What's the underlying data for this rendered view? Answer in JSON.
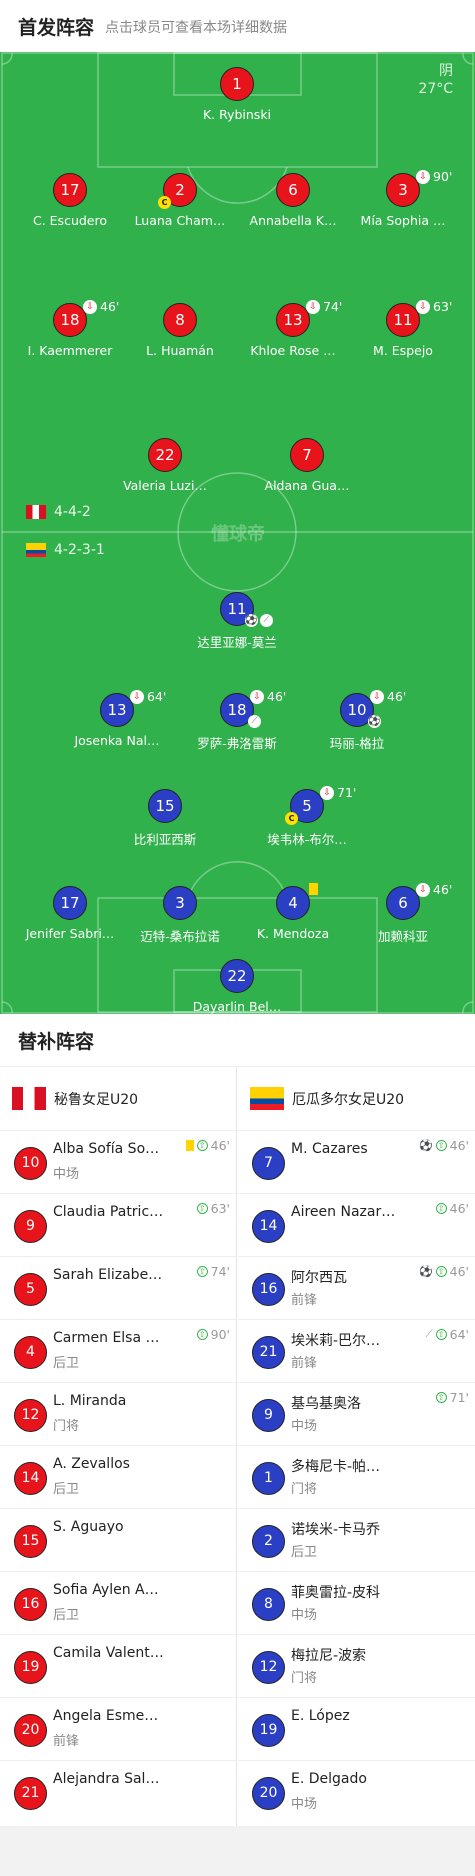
{
  "starting": {
    "title": "首发阵容",
    "subtitle": "点击球员可查看本场详细数据"
  },
  "weather": {
    "condition": "阴",
    "temp": "27°C"
  },
  "watermark": "懂球帝",
  "formations": {
    "home": "4-4-2",
    "away": "4-2-3-1"
  },
  "home_starters": [
    {
      "num": "1",
      "name": "K. Rybinski"
    },
    {
      "num": "17",
      "name": "C. Escudero"
    },
    {
      "num": "2",
      "name": "Luana Cham…",
      "captain": "C"
    },
    {
      "num": "6",
      "name": "Annabella K…"
    },
    {
      "num": "3",
      "name": "Mía Sophia …",
      "sub": "90'"
    },
    {
      "num": "18",
      "name": "I. Kaemmerer",
      "sub": "46'"
    },
    {
      "num": "8",
      "name": "L. Huamán"
    },
    {
      "num": "13",
      "name": "Khloe Rose …",
      "sub": "74'"
    },
    {
      "num": "11",
      "name": "M. Espejo",
      "sub": "63'"
    },
    {
      "num": "22",
      "name": "Valeria Luzi…"
    },
    {
      "num": "7",
      "name": "Aldana Gua…"
    }
  ],
  "away_starters": [
    {
      "num": "11",
      "name": "达里亚娜-莫兰",
      "goal": true,
      "assist": true
    },
    {
      "num": "13",
      "name": "Josenka Nal…",
      "sub": "64'"
    },
    {
      "num": "18",
      "name": "罗萨-弗洛雷斯",
      "sub": "46'",
      "assist": true
    },
    {
      "num": "10",
      "name": "玛丽-格拉",
      "sub": "46'",
      "goal": true
    },
    {
      "num": "15",
      "name": "比利亚西斯"
    },
    {
      "num": "5",
      "name": "埃韦林-布尔…",
      "sub": "71'",
      "captain": "C"
    },
    {
      "num": "17",
      "name": "Jenifer Sabri…"
    },
    {
      "num": "3",
      "name": "迈特-桑布拉诺"
    },
    {
      "num": "4",
      "name": "K. Mendoza",
      "yellow": true
    },
    {
      "num": "6",
      "name": "加赖科亚",
      "sub": "46'"
    },
    {
      "num": "22",
      "name": "Dayarlin Bel…"
    }
  ],
  "bench": {
    "title": "替补阵容",
    "home_team": "秘鲁女足U20",
    "away_team": "厄瓜多尔女足U20",
    "home": [
      {
        "num": "10",
        "name": "Alba Sofía So…",
        "pos": "中场",
        "yellow": true,
        "in": "46'"
      },
      {
        "num": "9",
        "name": "Claudia Patric…",
        "pos": "",
        "in": "63'"
      },
      {
        "num": "5",
        "name": "Sarah Elizabe…",
        "pos": "",
        "in": "74'"
      },
      {
        "num": "4",
        "name": "Carmen Elsa …",
        "pos": "后卫",
        "in": "90'"
      },
      {
        "num": "12",
        "name": "L. Miranda",
        "pos": "门将"
      },
      {
        "num": "14",
        "name": "A. Zevallos",
        "pos": "后卫"
      },
      {
        "num": "15",
        "name": "S. Aguayo",
        "pos": ""
      },
      {
        "num": "16",
        "name": "Sofia Aylen A…",
        "pos": "后卫"
      },
      {
        "num": "19",
        "name": "Camila Valent…",
        "pos": ""
      },
      {
        "num": "20",
        "name": "Angela Esme…",
        "pos": "前锋"
      },
      {
        "num": "21",
        "name": "Alejandra Sal…",
        "pos": ""
      }
    ],
    "away": [
      {
        "num": "7",
        "name": "M. Cazares",
        "pos": "",
        "goal": true,
        "in": "46'"
      },
      {
        "num": "14",
        "name": "Aireen Nazar…",
        "pos": "",
        "in": "46'"
      },
      {
        "num": "16",
        "name": "阿尔西瓦",
        "pos": "前锋",
        "goal": true,
        "in": "46'"
      },
      {
        "num": "21",
        "name": "埃米莉-巴尔…",
        "pos": "前锋",
        "assist": true,
        "in": "64'"
      },
      {
        "num": "9",
        "name": "基乌基奥洛",
        "pos": "中场",
        "in": "71'"
      },
      {
        "num": "1",
        "name": "多梅尼卡-帕…",
        "pos": "门将"
      },
      {
        "num": "2",
        "name": "诺埃米-卡马乔",
        "pos": "后卫"
      },
      {
        "num": "8",
        "name": "菲奥雷拉-皮科",
        "pos": "中场"
      },
      {
        "num": "12",
        "name": "梅拉尼-波索",
        "pos": "门将"
      },
      {
        "num": "19",
        "name": "E. López",
        "pos": ""
      },
      {
        "num": "20",
        "name": "E. Delgado",
        "pos": "中场"
      }
    ]
  }
}
